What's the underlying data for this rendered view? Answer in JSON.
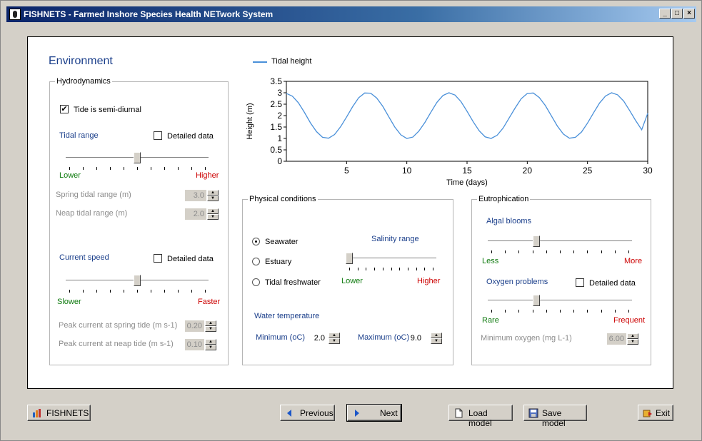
{
  "window": {
    "title": "FISHNETS - Farmed Inshore Species Health NETwork System",
    "controls": {
      "minimize": "_",
      "maximize": "□",
      "close": "×"
    }
  },
  "environment_title": "Environment",
  "hydrodynamics": {
    "legend": "Hydrodynamics",
    "tide_semidiurnal": {
      "label": "Tide is semi-diurnal",
      "checked": true
    },
    "tidal_range": {
      "label": "Tidal range",
      "detailed_label": "Detailed data",
      "low": "Lower",
      "high": "Higher",
      "level": 0.5
    },
    "spring_tidal_range": {
      "label": "Spring tidal range (m)",
      "value": "3.0"
    },
    "neap_tidal_range": {
      "label": "Neap tidal range (m)",
      "value": "2.0"
    },
    "current_speed": {
      "label": "Current speed",
      "detailed_label": "Detailed data",
      "low": "Slower",
      "high": "Faster",
      "level": 0.5
    },
    "peak_spring": {
      "label": "Peak current at spring tide  (m s-1)",
      "value": "0.20"
    },
    "peak_neap": {
      "label": "Peak current at neap tide  (m s-1)",
      "value": "0.10"
    }
  },
  "physical": {
    "legend": "Physical conditions",
    "options": [
      {
        "label": "Seawater",
        "selected": true
      },
      {
        "label": "Estuary",
        "selected": false
      },
      {
        "label": "Tidal freshwater",
        "selected": false
      }
    ],
    "salinity": {
      "label": "Salinity range",
      "low": "Lower",
      "high": "Higher",
      "level": 0
    },
    "water_temp_label": "Water temperature",
    "min_label": "Minimum (oC)",
    "min_value": "2.0",
    "max_label": "Maximum (oC)",
    "max_value": "9.0"
  },
  "eutrophication": {
    "legend": "Eutrophication",
    "algal": {
      "label": "Algal blooms",
      "low": "Less",
      "high": "More",
      "level": 0.33
    },
    "oxygen": {
      "label": "Oxygen problems",
      "detailed_label": "Detailed data",
      "low": "Rare",
      "high": "Frequent",
      "level": 0.33
    },
    "min_oxygen": {
      "label": "Minimum oxygen (mg L-1)",
      "value": "6.00"
    }
  },
  "buttons": {
    "fishnets": "FISHNETS",
    "previous": "Previous",
    "next": "Next",
    "load": "Load model",
    "save": "Save model",
    "exit": "Exit"
  },
  "colors": {
    "accent_blue": "#1b3f8b",
    "low_green": "#0e7a0e",
    "high_red": "#cc0000",
    "series": "#4a90d9"
  },
  "chart_data": {
    "type": "line",
    "series": [
      {
        "name": "Tidal height",
        "color": "#4a90d9",
        "x": [
          0,
          0.5,
          1,
          1.5,
          2,
          2.5,
          3,
          3.5,
          4,
          4.5,
          5,
          5.5,
          6,
          6.5,
          7,
          7.5,
          8,
          8.5,
          9,
          9.5,
          10,
          10.5,
          11,
          11.5,
          12,
          12.5,
          13,
          13.5,
          14,
          14.5,
          15,
          15.5,
          16,
          16.5,
          17,
          17.5,
          18,
          18.5,
          19,
          19.5,
          20,
          20.5,
          21,
          21.5,
          22,
          22.5,
          23,
          23.5,
          24,
          24.5,
          25,
          25.5,
          26,
          26.5,
          27,
          27.5,
          28,
          28.5,
          29,
          29.5,
          30
        ],
        "y": [
          2.97,
          2.85,
          2.56,
          2.14,
          1.68,
          1.3,
          1.05,
          1.01,
          1.17,
          1.51,
          1.94,
          2.39,
          2.78,
          2.99,
          2.98,
          2.77,
          2.41,
          1.95,
          1.5,
          1.16,
          1.0,
          1.06,
          1.32,
          1.7,
          2.15,
          2.58,
          2.88,
          3.0,
          2.9,
          2.61,
          2.19,
          1.74,
          1.34,
          1.07,
          1.0,
          1.14,
          1.46,
          1.9,
          2.34,
          2.74,
          2.97,
          2.99,
          2.79,
          2.44,
          1.99,
          1.54,
          1.19,
          1.01,
          1.05,
          1.28,
          1.67,
          2.12,
          2.55,
          2.86,
          3.0,
          2.91,
          2.64,
          2.22,
          1.78,
          1.38,
          2.1
        ]
      }
    ],
    "xlabel": "Time (days)",
    "ylabel": "Height (m)",
    "xlim": [
      0,
      30
    ],
    "ylim": [
      0,
      3.5
    ],
    "xticks": [
      5,
      10,
      15,
      20,
      25,
      30
    ],
    "yticks": [
      0,
      0.5,
      1,
      1.5,
      2,
      2.5,
      3,
      3.5
    ],
    "ytick_labels": [
      "0",
      "0.5",
      "1",
      "1.5",
      "2",
      "2.5",
      "3",
      "3.5"
    ],
    "legend": "top-left",
    "grid": false
  }
}
